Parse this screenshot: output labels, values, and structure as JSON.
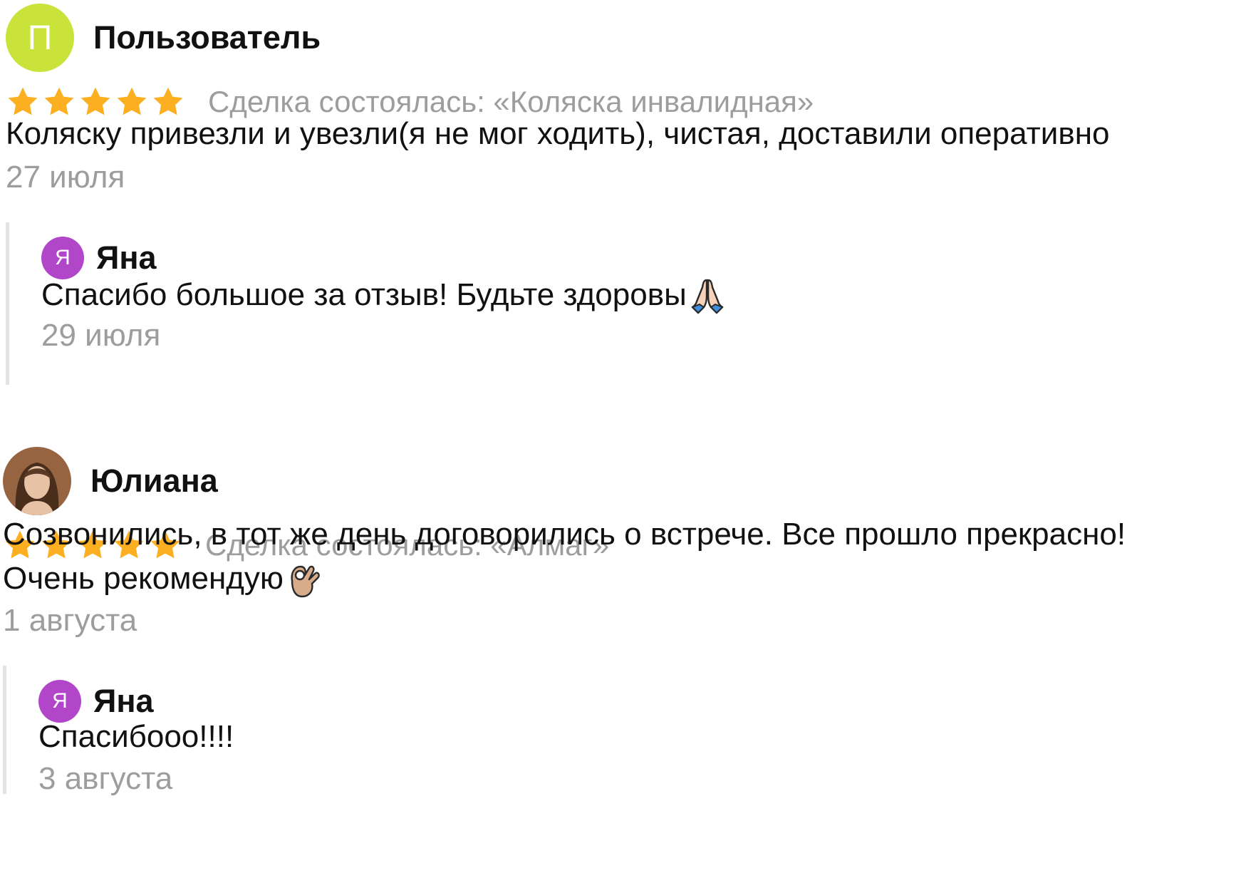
{
  "reviews": [
    {
      "author": {
        "initial": "П",
        "name": "Пользователь",
        "avatar_color": "#c9e33b"
      },
      "rating": 5,
      "deal_text": "Сделка состоялась: «Коляска инвалидная»",
      "text_lines": [
        "Коляску привезли и увезли(я не мог ходить), чистая, доставили оперативно"
      ],
      "date": "27 июля",
      "reply": {
        "author_initial": "Я",
        "author_name": "Яна",
        "text": "Спасибо большое за отзыв! Будьте здоровы",
        "emoji": "praying-hands-icon",
        "date": "29 июля"
      }
    },
    {
      "author": {
        "initial": "",
        "name": "Юлиана",
        "avatar_photo": "avatar-photo"
      },
      "rating": 5,
      "deal_text": "Сделка состоялась: «Алмаг»",
      "text_lines": [
        "Созвонились, в тот же день договорились о встрече. Все прошло прекрасно!",
        "Очень рекомендую"
      ],
      "text_emoji": "ok-hand-icon",
      "date": "1 августа",
      "reply": {
        "author_initial": "Я",
        "author_name": "Яна",
        "text": "Спасибооо!!!!",
        "date": "3 августа"
      }
    }
  ],
  "colors": {
    "star": "#fcb021",
    "muted_text": "#9d9d9d",
    "reply_avatar": "#b146c9",
    "reply_border": "#e3e3e3"
  }
}
